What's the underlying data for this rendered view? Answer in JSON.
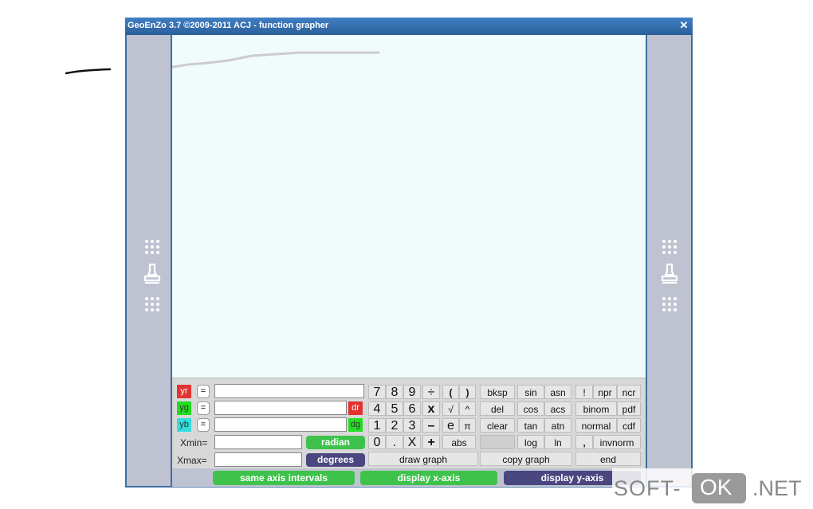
{
  "window": {
    "title": "GeoEnZo 3.7 ©2009-2011 ACJ - function grapher",
    "close_glyph": "✕"
  },
  "side_panels": {
    "icons": [
      "grip-dots-icon",
      "stamp-icon",
      "grip-dots-icon"
    ]
  },
  "inputs": {
    "yr": {
      "label": "yr",
      "eq": "=",
      "value": ""
    },
    "yg": {
      "label": "yg",
      "eq": "=",
      "value": "",
      "tag": "dr"
    },
    "yb": {
      "label": "yb",
      "eq": "=",
      "value": "",
      "tag": "dg"
    },
    "xmin": {
      "label": "Xmin=",
      "value": ""
    },
    "xmax": {
      "label": "Xmax=",
      "value": ""
    }
  },
  "modes": {
    "radian": "radian",
    "degrees": "degrees"
  },
  "keypad": {
    "digits": [
      "7",
      "8",
      "9",
      "4",
      "5",
      "6",
      "1",
      "2",
      "3",
      "0",
      ".",
      "X"
    ],
    "ops": [
      "÷",
      "x",
      "–",
      "+"
    ],
    "funcs1": [
      "(",
      ")",
      "√",
      "^",
      "e",
      "π",
      "abs"
    ],
    "edit": [
      "bksp",
      "del",
      "clear"
    ],
    "trig": [
      "sin",
      "asn",
      "cos",
      "acs",
      "tan",
      "atn",
      "log",
      "ln"
    ],
    "stats": [
      "!",
      "npr",
      "ncr",
      "binom",
      "pdf",
      "normal",
      "cdf",
      ",",
      "invnorm"
    ],
    "draw_graph": "draw graph",
    "copy_graph": "copy graph",
    "end": "end"
  },
  "bottom_buttons": {
    "same_axis": "same axis intervals",
    "display_x": "display x-axis",
    "display_y": "display y-axis"
  },
  "watermark": {
    "left": "SOFT-",
    "box": "OK",
    "right": ".NET"
  }
}
